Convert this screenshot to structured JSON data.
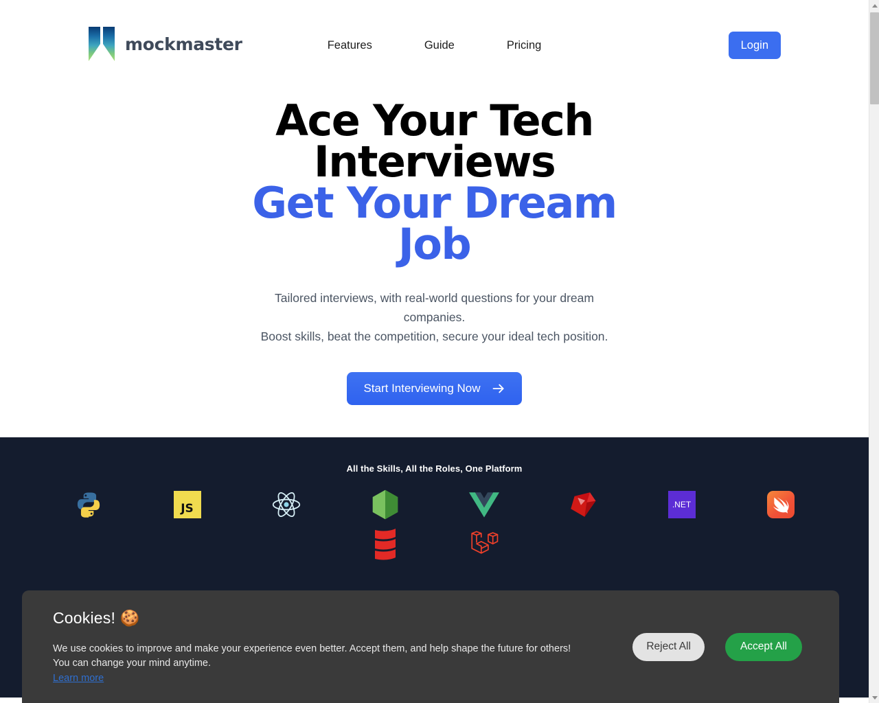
{
  "brand": {
    "name": "mockmaster",
    "logo_icon": "mockmaster-butterfly-logo",
    "gradient_top": "#0b4f8f",
    "gradient_mid": "#3aa0c8",
    "gradient_bottom": "#9fd86a"
  },
  "nav": {
    "links": [
      {
        "label": "Features"
      },
      {
        "label": "Guide"
      },
      {
        "label": "Pricing"
      }
    ],
    "login_label": "Login",
    "login_color": "#3b6ef0"
  },
  "hero": {
    "title_line1": "Ace Your Tech",
    "title_line2": "Interviews",
    "title_accent": "Get Your Dream Job",
    "accent_color": "#3b62e8",
    "sub_line1": "Tailored interviews, with real-world questions for your dream",
    "sub_line2": "companies.",
    "sub_line3": "Boost skills, beat the competition, secure your ideal tech position.",
    "cta_label": "Start Interviewing Now",
    "cta_icon": "arrow-right-icon"
  },
  "tech": {
    "heading": "All the Skills, All the Roles, One Platform",
    "background": "#141c2e",
    "row1": [
      {
        "name": "python",
        "label": "Python"
      },
      {
        "name": "javascript",
        "label": "JS"
      },
      {
        "name": "react",
        "label": "React"
      },
      {
        "name": "nodejs",
        "label": "Node.js"
      },
      {
        "name": "vue",
        "label": "Vue"
      },
      {
        "name": "ruby",
        "label": "Ruby"
      },
      {
        "name": "dotnet",
        "label": ".NET"
      },
      {
        "name": "swift",
        "label": "Swift"
      }
    ],
    "row2": [
      {
        "name": "scala",
        "label": "Scala"
      },
      {
        "name": "laravel",
        "label": "Laravel"
      }
    ]
  },
  "cookies": {
    "title": "Cookies! 🍪",
    "body_line1": "We use cookies to improve and make your experience even better. Accept them, and help shape the future for others!",
    "body_line2": "You can change your mind anytime.",
    "link_label": "Learn more",
    "reject_label": "Reject All",
    "accept_label": "Accept All",
    "accept_color": "#24a148",
    "reject_color": "#e3e3e3"
  },
  "scrollbar": {
    "up_icon": "caret-up-icon",
    "down_icon": "caret-down-icon"
  }
}
